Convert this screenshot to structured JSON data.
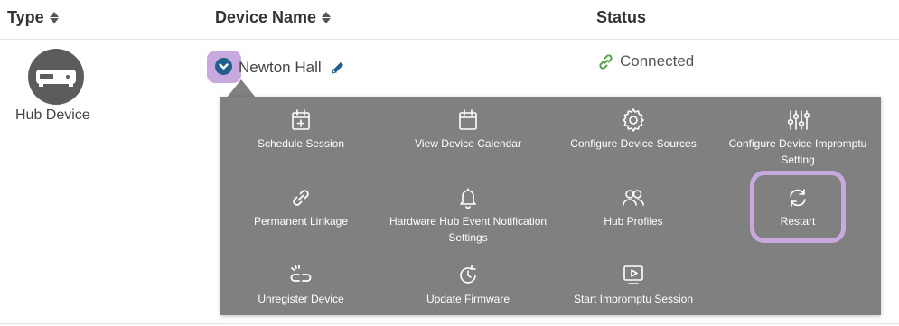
{
  "table": {
    "columns": [
      {
        "label": "Type",
        "sortable": true
      },
      {
        "label": "Device Name",
        "sortable": true
      },
      {
        "label": "Status",
        "sortable": false
      }
    ],
    "row": {
      "type_label": "Hub Device",
      "type_icon": "hub-device-icon",
      "device_name": "Newton Hall",
      "status": "Connected",
      "status_icon": "link-icon"
    }
  },
  "menu": {
    "items": [
      {
        "label": "Schedule Session",
        "icon": "calendar-plus-icon"
      },
      {
        "label": "View Device Calendar",
        "icon": "calendar-icon"
      },
      {
        "label": "Configure Device Sources",
        "icon": "gear-icon"
      },
      {
        "label": "Configure Device Impromptu Setting",
        "icon": "sliders-icon"
      },
      {
        "label": "Permanent Linkage",
        "icon": "link-icon"
      },
      {
        "label": "Hardware Hub Event Notification Settings",
        "icon": "bell-icon"
      },
      {
        "label": "Hub Profiles",
        "icon": "users-icon"
      },
      {
        "label": "Restart",
        "icon": "refresh-icon"
      },
      {
        "label": "Unregister Device",
        "icon": "broken-link-icon"
      },
      {
        "label": "Update Firmware",
        "icon": "clock-refresh-icon"
      },
      {
        "label": "Start Impromptu Session",
        "icon": "play-screen-icon"
      }
    ]
  },
  "colors": {
    "menu_bg": "#808080",
    "highlight": "#c8a9dd",
    "accent_blue": "#1f5f8b",
    "link_green": "#5a9e4f"
  }
}
